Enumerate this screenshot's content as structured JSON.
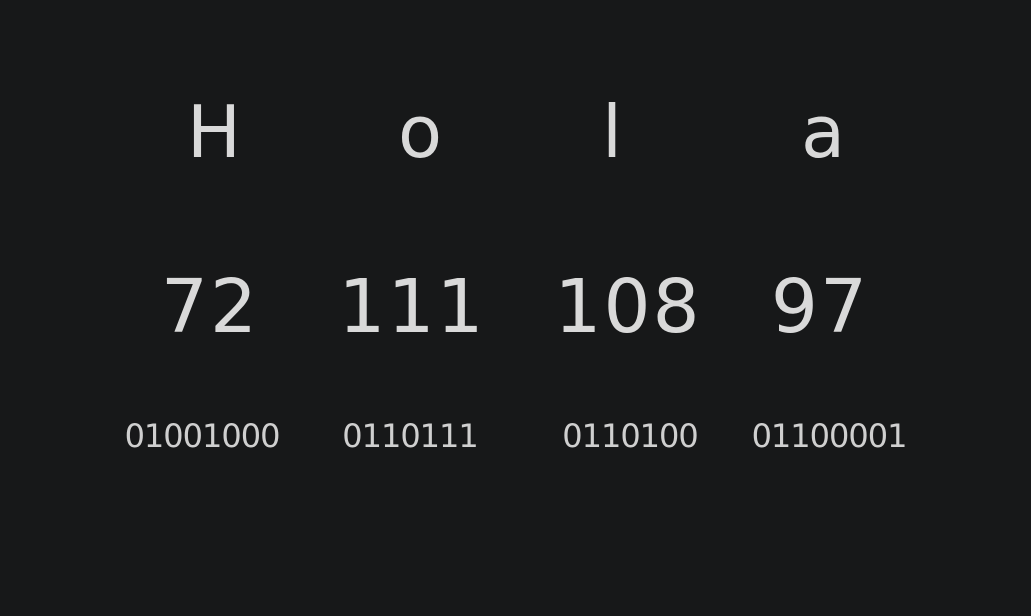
{
  "colors": {
    "background": "#171819",
    "ink": "#d9d9d9"
  },
  "columns": [
    {
      "letter": "H",
      "decimal": "72",
      "binary": "01001000"
    },
    {
      "letter": "o",
      "decimal": "111",
      "binary": "0110111"
    },
    {
      "letter": "l",
      "decimal": "108",
      "binary": "0110100"
    },
    {
      "letter": "a",
      "decimal": "97",
      "binary": "01100001"
    }
  ]
}
